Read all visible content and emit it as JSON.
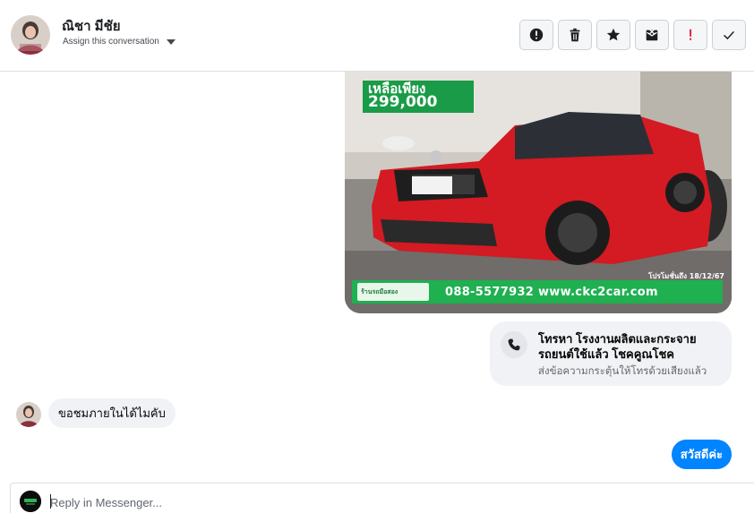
{
  "header": {
    "contact_name": "ณิชา มีชัย",
    "assign_label": "Assign this conversation",
    "actions": [
      {
        "name": "report-button",
        "icon": "alert-circle-icon"
      },
      {
        "name": "delete-button",
        "icon": "trash-icon"
      },
      {
        "name": "star-button",
        "icon": "star-icon"
      },
      {
        "name": "mark-unread-button",
        "icon": "envelope-x-icon"
      },
      {
        "name": "flag-important-button",
        "icon": "exclamation-icon"
      },
      {
        "name": "mark-done-button",
        "icon": "check-icon"
      }
    ]
  },
  "attachment": {
    "price_line1": "เหลือเพียง",
    "price_line2": "299,000",
    "date_stamp": "โปรโมชั่นถึง 18/12/67",
    "brand_text": "ร้านรถมือสอง",
    "contact_text": "088-5577932 www.ckc2car.com"
  },
  "call_card": {
    "title": "โทรหา โรงงานผลิตและกระจายรถยนต์ใช้แล้ว โชคคูณโชค",
    "subtitle": "ส่งข้อความกระตุ้นให้โทรด้วยเสียงแล้ว",
    "icon": "phone-icon"
  },
  "messages": {
    "incoming_text": "ขอชมภายในได้ไมคับ",
    "outgoing_text": "สวัสดีค่ะ"
  },
  "composer": {
    "placeholder": "Reply in Messenger..."
  },
  "colors": {
    "accent": "#0084ff",
    "bubble_gray": "#f0f2f5",
    "alert_red": "#e41e3f",
    "promo_green": "#1fb050"
  }
}
